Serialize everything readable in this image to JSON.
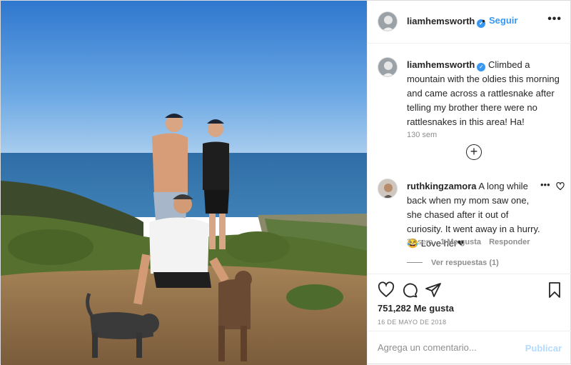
{
  "post": {
    "image_alt_icon": "photo",
    "author": {
      "username": "liamhemsworth",
      "verified_icon": "verified-badge-icon",
      "follow_label": "Seguir",
      "separator": "•"
    },
    "more_icon": "more-options-icon",
    "caption": {
      "username": "liamhemsworth",
      "text": "Climbed a mountain with the oldies this morning and came across a rattlesnake after telling my brother there were no rattlesnakes in this area! Ha!",
      "time": "130 sem"
    },
    "load_more_icon": "plus-circle-icon",
    "comments": [
      {
        "username": "ruthkingzamora",
        "text": "A long while back when my mom saw one, she chased after it out of curiosity. It went away in a hurry. 😂 Love her❤",
        "more": "•••",
        "time": "37 sem",
        "likes": "1 Me gusta",
        "reply": "Responder",
        "view_replies": "Ver respuestas (1)"
      }
    ],
    "likes": "751,282 Me gusta",
    "date": "16 DE MAYO DE 2018",
    "add_comment_placeholder": "Agrega un comentario...",
    "publish_label": "Publicar",
    "colors": {
      "link": "#3897f0",
      "publish_disabled": "#b3dbff",
      "muted": "#8e8e8e",
      "text": "#262626"
    }
  }
}
